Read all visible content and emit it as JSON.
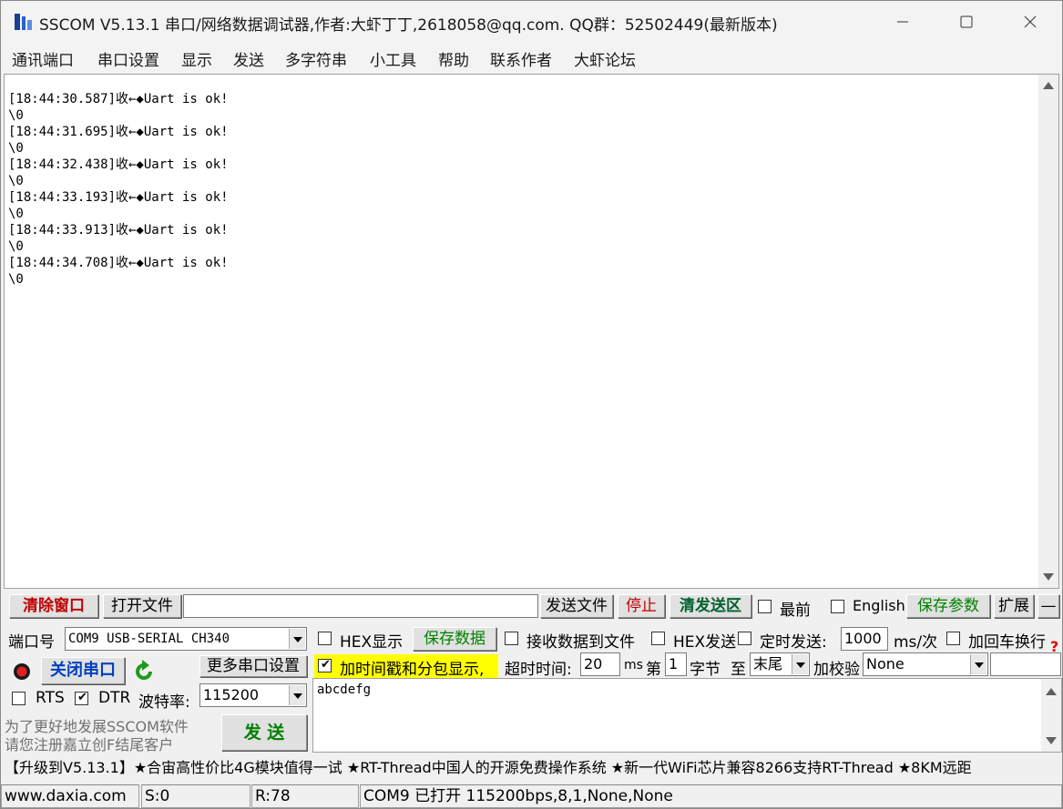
{
  "window": {
    "title": "SSCOM V5.13.1 串口/网络数据调试器,作者:大虾丁丁,2618058@qq.com. QQ群：52502449(最新版本)"
  },
  "menu": [
    "通讯端口",
    "串口设置",
    "显示",
    "发送",
    "多字符串",
    "小工具",
    "帮助",
    "联系作者",
    "大虾论坛"
  ],
  "receive": {
    "lines": "[18:44:30.587]收←◆Uart is ok!\n\\0\n[18:44:31.695]收←◆Uart is ok!\n\\0\n[18:44:32.438]收←◆Uart is ok!\n\\0\n[18:44:33.193]收←◆Uart is ok!\n\\0\n[18:44:33.913]收←◆Uart is ok!\n\\0\n[18:44:34.708]收←◆Uart is ok!\n\\0"
  },
  "toolbar": {
    "clear_window": "清除窗口",
    "open_file": "打开文件",
    "file_path": "",
    "send_file": "发送文件",
    "stop": "停止",
    "clear_send": "清发送区",
    "topmost": "最前",
    "english": "English",
    "save_params": "保存参数",
    "expand": "扩展",
    "collapse": "—"
  },
  "port": {
    "label": "端口号",
    "value": "COM9 USB-SERIAL CH340",
    "close_button": "关闭串口",
    "more_settings": "更多串口设置",
    "rts_label": "RTS",
    "dtr_label": "DTR",
    "baud_label": "波特率:",
    "baud_value": "115200",
    "promo_line1": "为了更好地发展SSCOM软件",
    "promo_line2": "请您注册嘉立创F结尾客户",
    "send_button": "发  送"
  },
  "options": {
    "hex_display": "HEX显示",
    "save_data": "保存数据",
    "recv_to_file": "接收数据到文件",
    "hex_send": "HEX发送",
    "timed_send": "定时发送:",
    "interval_value": "1000",
    "interval_unit": "ms/次",
    "add_crlf": "加回车换行",
    "timestamp": "加时间戳和分包显示,",
    "timeout_label": "超时时间:",
    "timeout_value": "20",
    "timeout_unit": "ms",
    "nth_label": "第",
    "byte_value": "1",
    "byte_label": "字节",
    "to_label": "至",
    "end_value": "末尾",
    "checksum_label": "加校验",
    "checksum_value": "None",
    "help": "?"
  },
  "send_area": {
    "text": "abcdefg"
  },
  "ticker": "【升级到V5.13.1】★合宙高性价比4G模块值得一试 ★RT-Thread中国人的开源免费操作系统 ★新一代WiFi芯片兼容8266支持RT-Thread ★8KM远距",
  "status": {
    "website": "www.daxia.com",
    "sent": "S:0",
    "received": "R:78",
    "port_state": "COM9 已打开  115200bps,8,1,None,None"
  },
  "colors": {
    "clear_window_text": "#c00000",
    "stop_text": "#c00000",
    "clear_send_text": "#006030",
    "save_green": "#008000",
    "close_port_text": "#0040c0",
    "timestamp_bg": "#ffff00",
    "recv_to_file_text": "#000080"
  }
}
